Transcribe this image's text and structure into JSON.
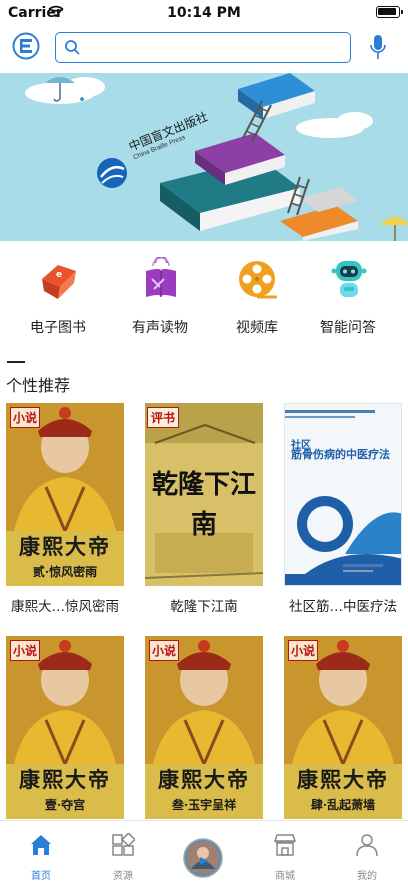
{
  "status_bar": {
    "carrier": "Carrier",
    "time": "10:14 PM"
  },
  "header": {
    "search_placeholder": "",
    "logo_icon": "library-logo-icon",
    "mic_icon": "microphone-icon"
  },
  "banner": {
    "press_name_cn": "中国盲文出版社",
    "press_name_en": "China Braille Press"
  },
  "quick_menu": [
    {
      "label": "电子图书",
      "icon": "ebook-icon",
      "color": "#e8522f"
    },
    {
      "label": "有声读物",
      "icon": "audiobook-icon",
      "color": "#9b3bbf"
    },
    {
      "label": "视频库",
      "icon": "film-reel-icon",
      "color": "#f0a020"
    },
    {
      "label": "智能问答",
      "icon": "robot-icon",
      "color": "#35c5c0"
    }
  ],
  "section": {
    "title": "个性推荐"
  },
  "books": [
    {
      "title": "康熙大…惊风密雨",
      "badge": "小说",
      "cover_title": "康熙大帝",
      "cover_sub": "贰·惊风密雨"
    },
    {
      "title": "乾隆下江南",
      "badge": "评书",
      "cover_title": "乾隆下江南"
    },
    {
      "title": "社区筋…中医疗法",
      "badge": "社区",
      "cover_title": "筋骨伤病的中医疗法"
    },
    {
      "title": "",
      "badge": "小说",
      "cover_title": "康熙大帝",
      "cover_sub": "壹·夺宫"
    },
    {
      "title": "",
      "badge": "小说",
      "cover_title": "康熙大帝",
      "cover_sub": "叁·玉宇呈祥"
    },
    {
      "title": "",
      "badge": "小说",
      "cover_title": "康熙大帝",
      "cover_sub": "肆·乱起萧墙"
    }
  ],
  "tab_bar": {
    "tabs": [
      {
        "label": "首页",
        "icon": "home-icon",
        "active": true
      },
      {
        "label": "资源",
        "icon": "grid-icon",
        "active": false
      },
      {
        "label": "",
        "icon": "player-avatar-icon",
        "active": false
      },
      {
        "label": "商城",
        "icon": "shop-icon",
        "active": false
      },
      {
        "label": "我的",
        "icon": "person-icon",
        "active": false
      }
    ]
  },
  "colors": {
    "accent": "#2a7ed8",
    "banner_bg": "#a8dce8"
  }
}
